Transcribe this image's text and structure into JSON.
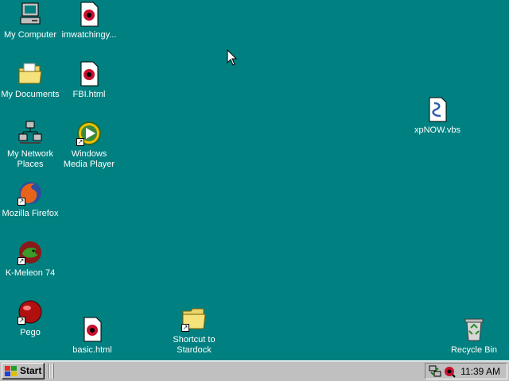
{
  "desktop": {
    "background": "#008080",
    "icons": {
      "my_computer": "My Computer",
      "imwatching": "imwatchingy...",
      "my_documents": "My Documents",
      "fbi": "FBI.html",
      "xpnow": "xpNOW.vbs",
      "my_network": "My Network Places",
      "wmp": "Windows Media Player",
      "firefox": "Mozilla Firefox",
      "kmeleon": "K-Meleon 74",
      "pego": "Pego",
      "basic": "basic.html",
      "stardock": "Shortcut to Stardock",
      "recycle": "Recycle Bin"
    }
  },
  "taskbar": {
    "start_label": "Start",
    "clock": "11:39 AM",
    "tray_icons": [
      "network-tray-icon",
      "media-tray-icon"
    ]
  }
}
